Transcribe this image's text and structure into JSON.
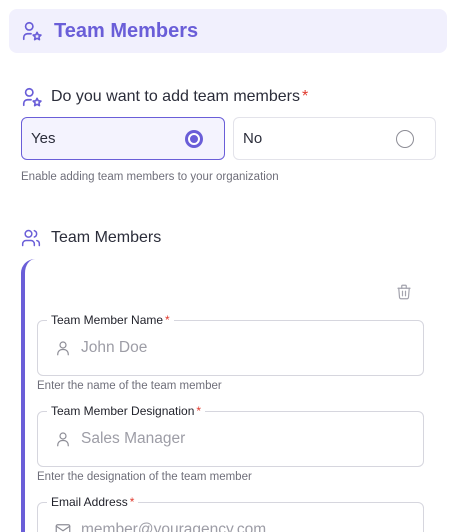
{
  "header": {
    "title": "Team Members",
    "icon": "user-star-icon"
  },
  "question": {
    "label": "Do you want to add team members",
    "required_mark": "*",
    "options": [
      {
        "label": "Yes",
        "selected": true
      },
      {
        "label": "No",
        "selected": false
      }
    ],
    "hint": "Enable adding team members to your organization"
  },
  "members_section": {
    "title": "Team Members",
    "icon": "users-icon"
  },
  "member_form": {
    "name": {
      "label": "Team Member Name",
      "required_mark": "*",
      "placeholder": "John Doe",
      "hint": "Enter the name of the team member"
    },
    "designation": {
      "label": "Team Member Designation",
      "required_mark": "*",
      "placeholder": "Sales Manager",
      "hint": "Enter the designation of the team member"
    },
    "email": {
      "label": "Email Address",
      "required_mark": "*",
      "placeholder": "member@youragency.com"
    }
  },
  "colors": {
    "accent": "#6a5ed8",
    "required": "#e0392d",
    "header_bg": "#f1f0fd"
  }
}
